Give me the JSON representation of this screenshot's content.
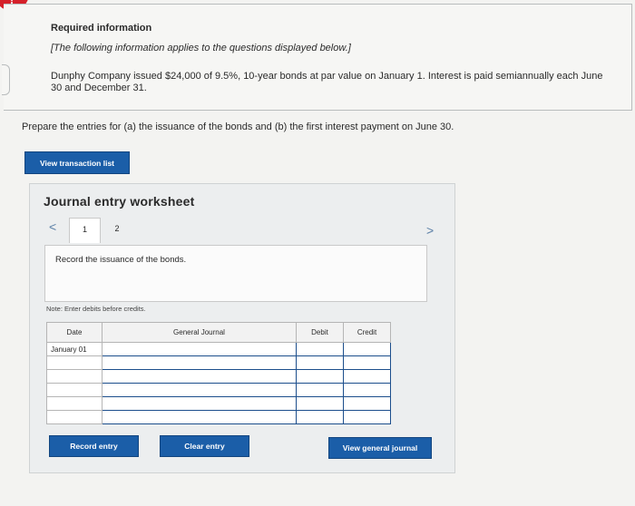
{
  "alert": {
    "symbol": "!"
  },
  "info": {
    "title": "Required information",
    "note": "[The following information applies to the questions displayed below.]",
    "text": "Dunphy Company issued $24,000 of 9.5%, 10-year bonds at par value on January 1. Interest is paid semiannually each June 30 and December 31."
  },
  "prompt": "Prepare the entries for (a) the issuance of the bonds and (b) the first interest payment on June 30.",
  "buttons": {
    "view_transaction_list": "View transaction list",
    "record_entry": "Record entry",
    "clear_entry": "Clear entry",
    "view_general_journal": "View general journal"
  },
  "worksheet": {
    "title": "Journal entry worksheet",
    "prev": "<",
    "next": ">",
    "tabs": [
      "1",
      "2"
    ],
    "instruction": "Record the issuance of the bonds.",
    "note": "Note: Enter debits before credits.",
    "columns": {
      "date": "Date",
      "general_journal": "General Journal",
      "debit": "Debit",
      "credit": "Credit"
    },
    "rows": [
      {
        "date": "January 01",
        "account": "",
        "debit": "",
        "credit": ""
      },
      {
        "date": "",
        "account": "",
        "debit": "",
        "credit": ""
      },
      {
        "date": "",
        "account": "",
        "debit": "",
        "credit": ""
      },
      {
        "date": "",
        "account": "",
        "debit": "",
        "credit": ""
      },
      {
        "date": "",
        "account": "",
        "debit": "",
        "credit": ""
      },
      {
        "date": "",
        "account": "",
        "debit": "",
        "credit": ""
      }
    ]
  },
  "colors": {
    "button_blue": "#1b5ea8",
    "alert_red": "#d5202a",
    "grid_focus": "#1c4e8c"
  }
}
